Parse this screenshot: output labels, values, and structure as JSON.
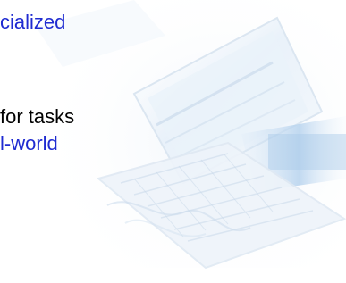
{
  "lines": [
    {
      "text": "cialized",
      "color": "#1f2bd1"
    },
    {
      "text": "for tasks",
      "color": "#000000"
    },
    {
      "text": "l-world",
      "color": "#1f2bd1"
    }
  ],
  "background": {
    "image": "faded-laptop-illustration",
    "tint": "#dfeaf5"
  }
}
